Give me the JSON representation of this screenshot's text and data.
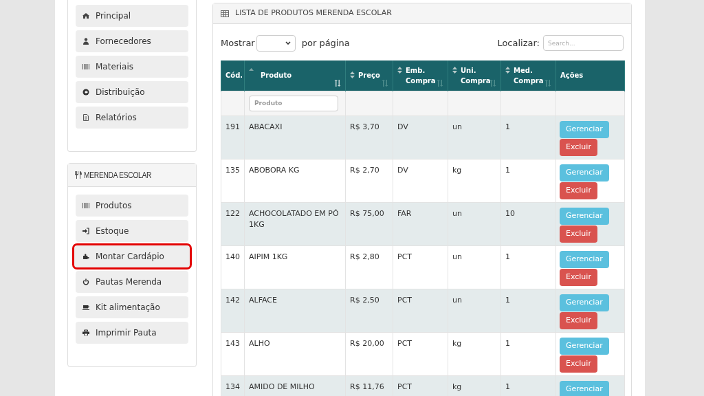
{
  "sidebar": {
    "main_menu": [
      {
        "label": "Principal",
        "highlighted": false
      },
      {
        "label": "Fornecedores",
        "highlighted": false
      },
      {
        "label": "Materiais",
        "highlighted": false
      },
      {
        "label": "Distribuição",
        "highlighted": false
      },
      {
        "label": "Relatórios",
        "highlighted": false
      }
    ],
    "merenda_panel": {
      "title": "MERENDA ESCOLAR",
      "items": [
        {
          "label": "Produtos",
          "highlighted": false
        },
        {
          "label": "Estoque",
          "highlighted": false
        },
        {
          "label": "Montar Cardápio",
          "highlighted": true
        },
        {
          "label": "Pautas Merenda",
          "highlighted": false
        },
        {
          "label": "Kit alimentação",
          "highlighted": false
        },
        {
          "label": "Imprimir Pauta",
          "highlighted": false
        }
      ]
    }
  },
  "panel": {
    "title": "LISTA DE PRODUTOS MERENDA ESCOLAR",
    "show_label": "Mostrar",
    "per_page_label": "por página",
    "search_label": "Localizar:",
    "search": {
      "placeholder": "Search..."
    },
    "table": {
      "columns": [
        {
          "label": "Cód.",
          "sortable": false,
          "sorted": false
        },
        {
          "label": "Produto",
          "sortable": true,
          "sorted": true
        },
        {
          "label": "Preço",
          "sortable": true,
          "sorted": false
        },
        {
          "label": "Emb. Compra",
          "sortable": true,
          "sorted": false
        },
        {
          "label": "Uni. Compra",
          "sortable": true,
          "sorted": false
        },
        {
          "label": "Med. Compra",
          "sortable": true,
          "sorted": false
        },
        {
          "label": "Ações",
          "sortable": false,
          "sorted": false
        }
      ],
      "filter": {
        "placeholder": "Produto"
      },
      "rows": [
        {
          "cells": [
            "191",
            "ABACAXI",
            "R$ 3,70",
            "DV",
            "un",
            "1"
          ],
          "actions": [
            "Gerenciar",
            "Excluir"
          ]
        },
        {
          "cells": [
            "135",
            "ABOBORA KG",
            "R$ 2,70",
            "DV",
            "kg",
            "1"
          ],
          "actions": [
            "Gerenciar",
            "Excluir"
          ]
        },
        {
          "cells": [
            "122",
            "ACHOCOLATADO EM PÓ 1KG",
            "R$ 75,00",
            "FAR",
            "un",
            "10"
          ],
          "actions": [
            "Gerenciar",
            "Excluir"
          ]
        },
        {
          "cells": [
            "140",
            "AIPIM 1KG",
            "R$ 2,80",
            "PCT",
            "un",
            "1"
          ],
          "actions": [
            "Gerenciar",
            "Excluir"
          ]
        },
        {
          "cells": [
            "142",
            "ALFACE",
            "R$ 2,50",
            "PCT",
            "un",
            "1"
          ],
          "actions": [
            "Gerenciar",
            "Excluir"
          ]
        },
        {
          "cells": [
            "143",
            "ALHO",
            "R$ 20,00",
            "PCT",
            "kg",
            "1"
          ],
          "actions": [
            "Gerenciar",
            "Excluir"
          ]
        },
        {
          "cells": [
            "134",
            "AMIDO DE MILHO",
            "R$ 11,76",
            "PCT",
            "kg",
            "1"
          ],
          "actions": [
            "Gerenciar"
          ]
        }
      ]
    }
  }
}
